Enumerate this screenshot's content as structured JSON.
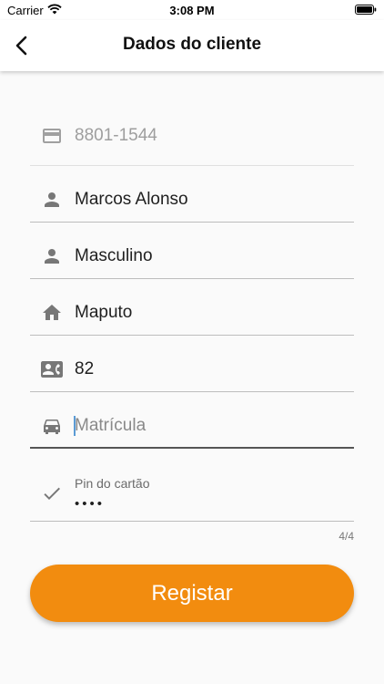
{
  "status_bar": {
    "carrier": "Carrier",
    "time": "3:08 PM"
  },
  "header": {
    "title": "Dados do cliente",
    "back_icon": "chevron-left-icon"
  },
  "form": {
    "card_number": {
      "value": "8801-1544",
      "icon": "credit-card-icon"
    },
    "name": {
      "value": "Marcos Alonso",
      "icon": "person-icon"
    },
    "gender": {
      "value": "Masculino",
      "icon": "person-icon"
    },
    "city": {
      "value": "Maputo",
      "icon": "home-icon"
    },
    "id_number": {
      "value": "82",
      "icon": "contact-card-icon"
    },
    "plate": {
      "placeholder": "Matrícula",
      "icon": "car-icon"
    },
    "pin": {
      "label": "Pin do cartão",
      "value": "••••",
      "icon": "check-icon",
      "counter": "4/4"
    }
  },
  "register_button": {
    "label": "Registar"
  },
  "colors": {
    "accent": "#f28c0f",
    "background": "#fafafa",
    "icon": "#777777"
  }
}
